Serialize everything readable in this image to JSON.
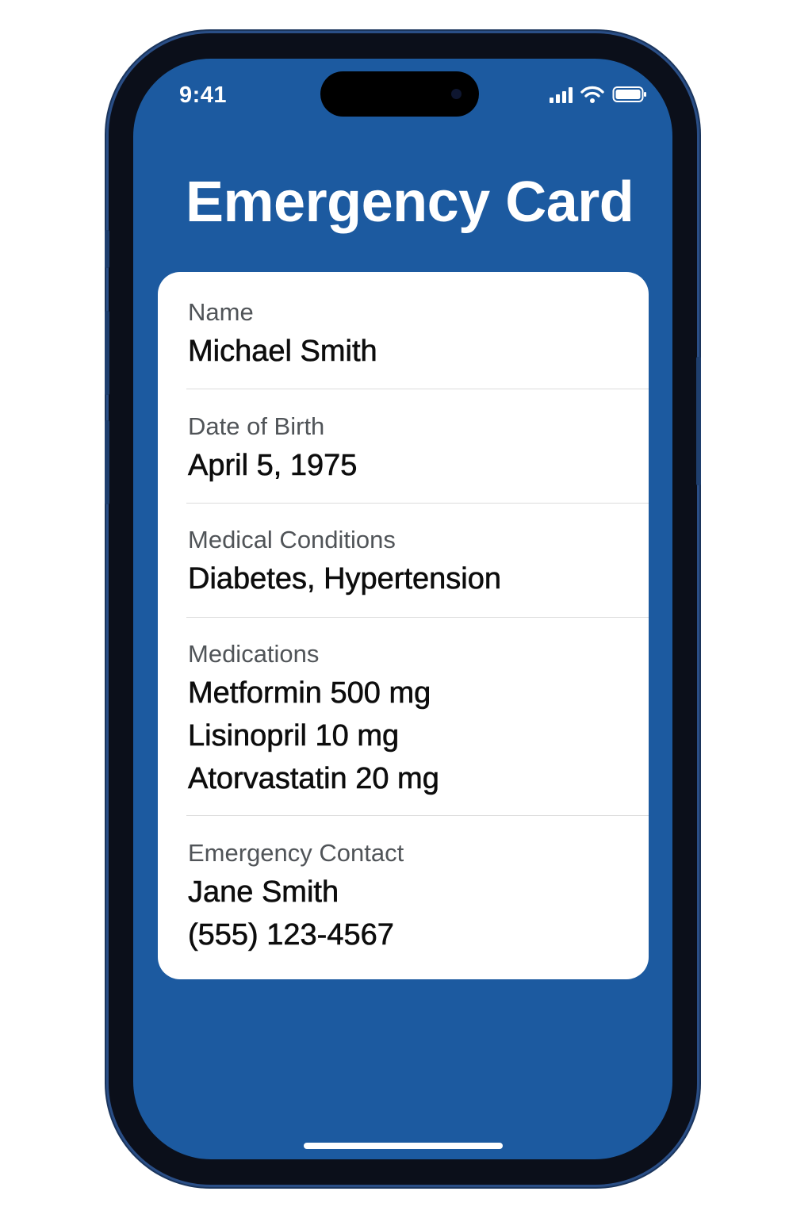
{
  "status_bar": {
    "time": "9:41",
    "icons": [
      "cellular-signal-icon",
      "wifi-icon",
      "battery-icon"
    ]
  },
  "title": "Emergency Card",
  "card": {
    "fields": [
      {
        "label": "Name",
        "values": [
          "Michael Smith"
        ]
      },
      {
        "label": "Date of Birth",
        "values": [
          "April 5, 1975"
        ]
      },
      {
        "label": "Medical Conditions",
        "values": [
          "Diabetes, Hypertension"
        ]
      },
      {
        "label": "Medications",
        "values": [
          "Metformin 500 mg",
          "Lisinopril 10 mg",
          "Atorvastatin 20 mg"
        ]
      },
      {
        "label": "Emergency Contact",
        "values": [
          "Jane Smith",
          "(555) 123-4567"
        ]
      }
    ]
  },
  "colors": {
    "screen_background": "#1c5aa0",
    "card_background": "#ffffff",
    "label_text": "#505458",
    "value_text": "#0d0d0d"
  }
}
